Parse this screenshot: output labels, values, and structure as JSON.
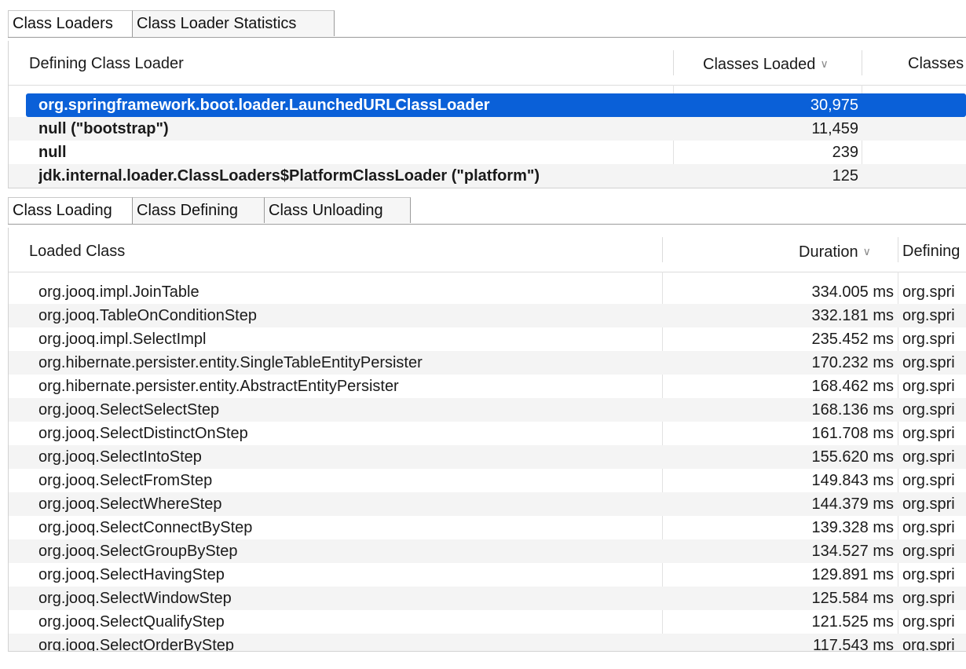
{
  "top_tabs": [
    {
      "label": "Class Loaders",
      "active": true
    },
    {
      "label": "Class Loader Statistics",
      "active": false
    }
  ],
  "loaders_table": {
    "columns": {
      "defining": "Defining Class Loader",
      "classes_loaded": "Classes Loaded",
      "classes_extra": "Classes"
    },
    "rows": [
      {
        "name": "org.springframework.boot.loader.LaunchedURLClassLoader",
        "count": "30,975",
        "selected": true
      },
      {
        "name": "null (\"bootstrap\")",
        "count": "11,459",
        "selected": false
      },
      {
        "name": "null",
        "count": "239",
        "selected": false
      },
      {
        "name": "jdk.internal.loader.ClassLoaders$PlatformClassLoader (\"platform\")",
        "count": "125",
        "selected": false
      }
    ]
  },
  "bottom_tabs": [
    {
      "label": "Class Loading",
      "active": true
    },
    {
      "label": "Class Defining",
      "active": false
    },
    {
      "label": "Class Unloading",
      "active": false
    }
  ],
  "loading_table": {
    "columns": {
      "loaded_class": "Loaded Class",
      "duration": "Duration",
      "defining": "Defining"
    },
    "rows": [
      {
        "cls": "org.jooq.impl.JoinTable",
        "duration": "334.005 ms",
        "defining": "org.spri"
      },
      {
        "cls": "org.jooq.TableOnConditionStep",
        "duration": "332.181 ms",
        "defining": "org.spri"
      },
      {
        "cls": "org.jooq.impl.SelectImpl",
        "duration": "235.452 ms",
        "defining": "org.spri"
      },
      {
        "cls": "org.hibernate.persister.entity.SingleTableEntityPersister",
        "duration": "170.232 ms",
        "defining": "org.spri"
      },
      {
        "cls": "org.hibernate.persister.entity.AbstractEntityPersister",
        "duration": "168.462 ms",
        "defining": "org.spri"
      },
      {
        "cls": "org.jooq.SelectSelectStep",
        "duration": "168.136 ms",
        "defining": "org.spri"
      },
      {
        "cls": "org.jooq.SelectDistinctOnStep",
        "duration": "161.708 ms",
        "defining": "org.spri"
      },
      {
        "cls": "org.jooq.SelectIntoStep",
        "duration": "155.620 ms",
        "defining": "org.spri"
      },
      {
        "cls": "org.jooq.SelectFromStep",
        "duration": "149.843 ms",
        "defining": "org.spri"
      },
      {
        "cls": "org.jooq.SelectWhereStep",
        "duration": "144.379 ms",
        "defining": "org.spri"
      },
      {
        "cls": "org.jooq.SelectConnectByStep",
        "duration": "139.328 ms",
        "defining": "org.spri"
      },
      {
        "cls": "org.jooq.SelectGroupByStep",
        "duration": "134.527 ms",
        "defining": "org.spri"
      },
      {
        "cls": "org.jooq.SelectHavingStep",
        "duration": "129.891 ms",
        "defining": "org.spri"
      },
      {
        "cls": "org.jooq.SelectWindowStep",
        "duration": "125.584 ms",
        "defining": "org.spri"
      },
      {
        "cls": "org.jooq.SelectQualifyStep",
        "duration": "121.525 ms",
        "defining": "org.spri"
      },
      {
        "cls": "org.jooq.SelectOrderByStep",
        "duration": "117.543 ms",
        "defining": "org.spri"
      }
    ]
  },
  "icons": {
    "sort_indicator": "chevron-down-icon"
  },
  "colors": {
    "selection": "#0a60d8",
    "stripe": "#f4f4f4"
  }
}
